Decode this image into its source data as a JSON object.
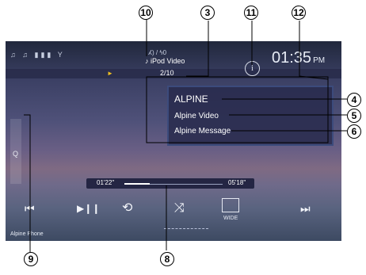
{
  "status": {
    "icons": "♫ ♫ ▮▮▮ Y",
    "volume": "ⵃ) / ϟ0"
  },
  "header": {
    "source": "♪ iPod Video",
    "track_number": "2/10",
    "play_indicator": "►",
    "time": "01:35",
    "ampm": "PM",
    "info": "i"
  },
  "info_panel": {
    "title": "ALPINE",
    "album": "Alpine Video",
    "artist": "Alpine Message"
  },
  "side_tab": {
    "icon": "Q"
  },
  "playback": {
    "elapsed": "01'22\"",
    "total": "05'18\"",
    "progress_fraction": 0.26
  },
  "controls": {
    "prev": "⏮",
    "play_pause": "▶❙❙",
    "repeat": "⟲",
    "shuffle": "⤨",
    "wide_label": "WIDE",
    "next": "⏭"
  },
  "footer": {
    "phone_label": "Alpine Phone"
  },
  "callouts": [
    "3",
    "4",
    "5",
    "6",
    "8",
    "9",
    "10",
    "11",
    "12"
  ],
  "colors": {
    "accent_play": "#f0c020",
    "callout_line": "#000000"
  }
}
